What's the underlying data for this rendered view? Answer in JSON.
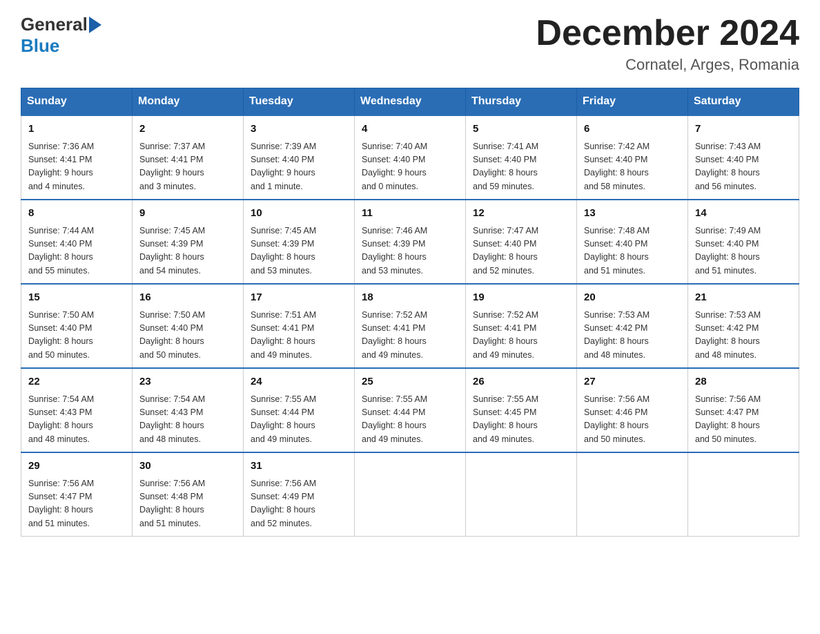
{
  "header": {
    "logo_general": "General",
    "logo_blue": "Blue",
    "month_title": "December 2024",
    "location": "Cornatel, Arges, Romania"
  },
  "weekdays": [
    "Sunday",
    "Monday",
    "Tuesday",
    "Wednesday",
    "Thursday",
    "Friday",
    "Saturday"
  ],
  "weeks": [
    [
      {
        "day": "1",
        "sunrise": "7:36 AM",
        "sunset": "4:41 PM",
        "daylight": "9 hours and 4 minutes."
      },
      {
        "day": "2",
        "sunrise": "7:37 AM",
        "sunset": "4:41 PM",
        "daylight": "9 hours and 3 minutes."
      },
      {
        "day": "3",
        "sunrise": "7:39 AM",
        "sunset": "4:40 PM",
        "daylight": "9 hours and 1 minute."
      },
      {
        "day": "4",
        "sunrise": "7:40 AM",
        "sunset": "4:40 PM",
        "daylight": "9 hours and 0 minutes."
      },
      {
        "day": "5",
        "sunrise": "7:41 AM",
        "sunset": "4:40 PM",
        "daylight": "8 hours and 59 minutes."
      },
      {
        "day": "6",
        "sunrise": "7:42 AM",
        "sunset": "4:40 PM",
        "daylight": "8 hours and 58 minutes."
      },
      {
        "day": "7",
        "sunrise": "7:43 AM",
        "sunset": "4:40 PM",
        "daylight": "8 hours and 56 minutes."
      }
    ],
    [
      {
        "day": "8",
        "sunrise": "7:44 AM",
        "sunset": "4:40 PM",
        "daylight": "8 hours and 55 minutes."
      },
      {
        "day": "9",
        "sunrise": "7:45 AM",
        "sunset": "4:39 PM",
        "daylight": "8 hours and 54 minutes."
      },
      {
        "day": "10",
        "sunrise": "7:45 AM",
        "sunset": "4:39 PM",
        "daylight": "8 hours and 53 minutes."
      },
      {
        "day": "11",
        "sunrise": "7:46 AM",
        "sunset": "4:39 PM",
        "daylight": "8 hours and 53 minutes."
      },
      {
        "day": "12",
        "sunrise": "7:47 AM",
        "sunset": "4:40 PM",
        "daylight": "8 hours and 52 minutes."
      },
      {
        "day": "13",
        "sunrise": "7:48 AM",
        "sunset": "4:40 PM",
        "daylight": "8 hours and 51 minutes."
      },
      {
        "day": "14",
        "sunrise": "7:49 AM",
        "sunset": "4:40 PM",
        "daylight": "8 hours and 51 minutes."
      }
    ],
    [
      {
        "day": "15",
        "sunrise": "7:50 AM",
        "sunset": "4:40 PM",
        "daylight": "8 hours and 50 minutes."
      },
      {
        "day": "16",
        "sunrise": "7:50 AM",
        "sunset": "4:40 PM",
        "daylight": "8 hours and 50 minutes."
      },
      {
        "day": "17",
        "sunrise": "7:51 AM",
        "sunset": "4:41 PM",
        "daylight": "8 hours and 49 minutes."
      },
      {
        "day": "18",
        "sunrise": "7:52 AM",
        "sunset": "4:41 PM",
        "daylight": "8 hours and 49 minutes."
      },
      {
        "day": "19",
        "sunrise": "7:52 AM",
        "sunset": "4:41 PM",
        "daylight": "8 hours and 49 minutes."
      },
      {
        "day": "20",
        "sunrise": "7:53 AM",
        "sunset": "4:42 PM",
        "daylight": "8 hours and 48 minutes."
      },
      {
        "day": "21",
        "sunrise": "7:53 AM",
        "sunset": "4:42 PM",
        "daylight": "8 hours and 48 minutes."
      }
    ],
    [
      {
        "day": "22",
        "sunrise": "7:54 AM",
        "sunset": "4:43 PM",
        "daylight": "8 hours and 48 minutes."
      },
      {
        "day": "23",
        "sunrise": "7:54 AM",
        "sunset": "4:43 PM",
        "daylight": "8 hours and 48 minutes."
      },
      {
        "day": "24",
        "sunrise": "7:55 AM",
        "sunset": "4:44 PM",
        "daylight": "8 hours and 49 minutes."
      },
      {
        "day": "25",
        "sunrise": "7:55 AM",
        "sunset": "4:44 PM",
        "daylight": "8 hours and 49 minutes."
      },
      {
        "day": "26",
        "sunrise": "7:55 AM",
        "sunset": "4:45 PM",
        "daylight": "8 hours and 49 minutes."
      },
      {
        "day": "27",
        "sunrise": "7:56 AM",
        "sunset": "4:46 PM",
        "daylight": "8 hours and 50 minutes."
      },
      {
        "day": "28",
        "sunrise": "7:56 AM",
        "sunset": "4:47 PM",
        "daylight": "8 hours and 50 minutes."
      }
    ],
    [
      {
        "day": "29",
        "sunrise": "7:56 AM",
        "sunset": "4:47 PM",
        "daylight": "8 hours and 51 minutes."
      },
      {
        "day": "30",
        "sunrise": "7:56 AM",
        "sunset": "4:48 PM",
        "daylight": "8 hours and 51 minutes."
      },
      {
        "day": "31",
        "sunrise": "7:56 AM",
        "sunset": "4:49 PM",
        "daylight": "8 hours and 52 minutes."
      },
      null,
      null,
      null,
      null
    ]
  ],
  "labels": {
    "sunrise": "Sunrise:",
    "sunset": "Sunset:",
    "daylight": "Daylight:"
  }
}
